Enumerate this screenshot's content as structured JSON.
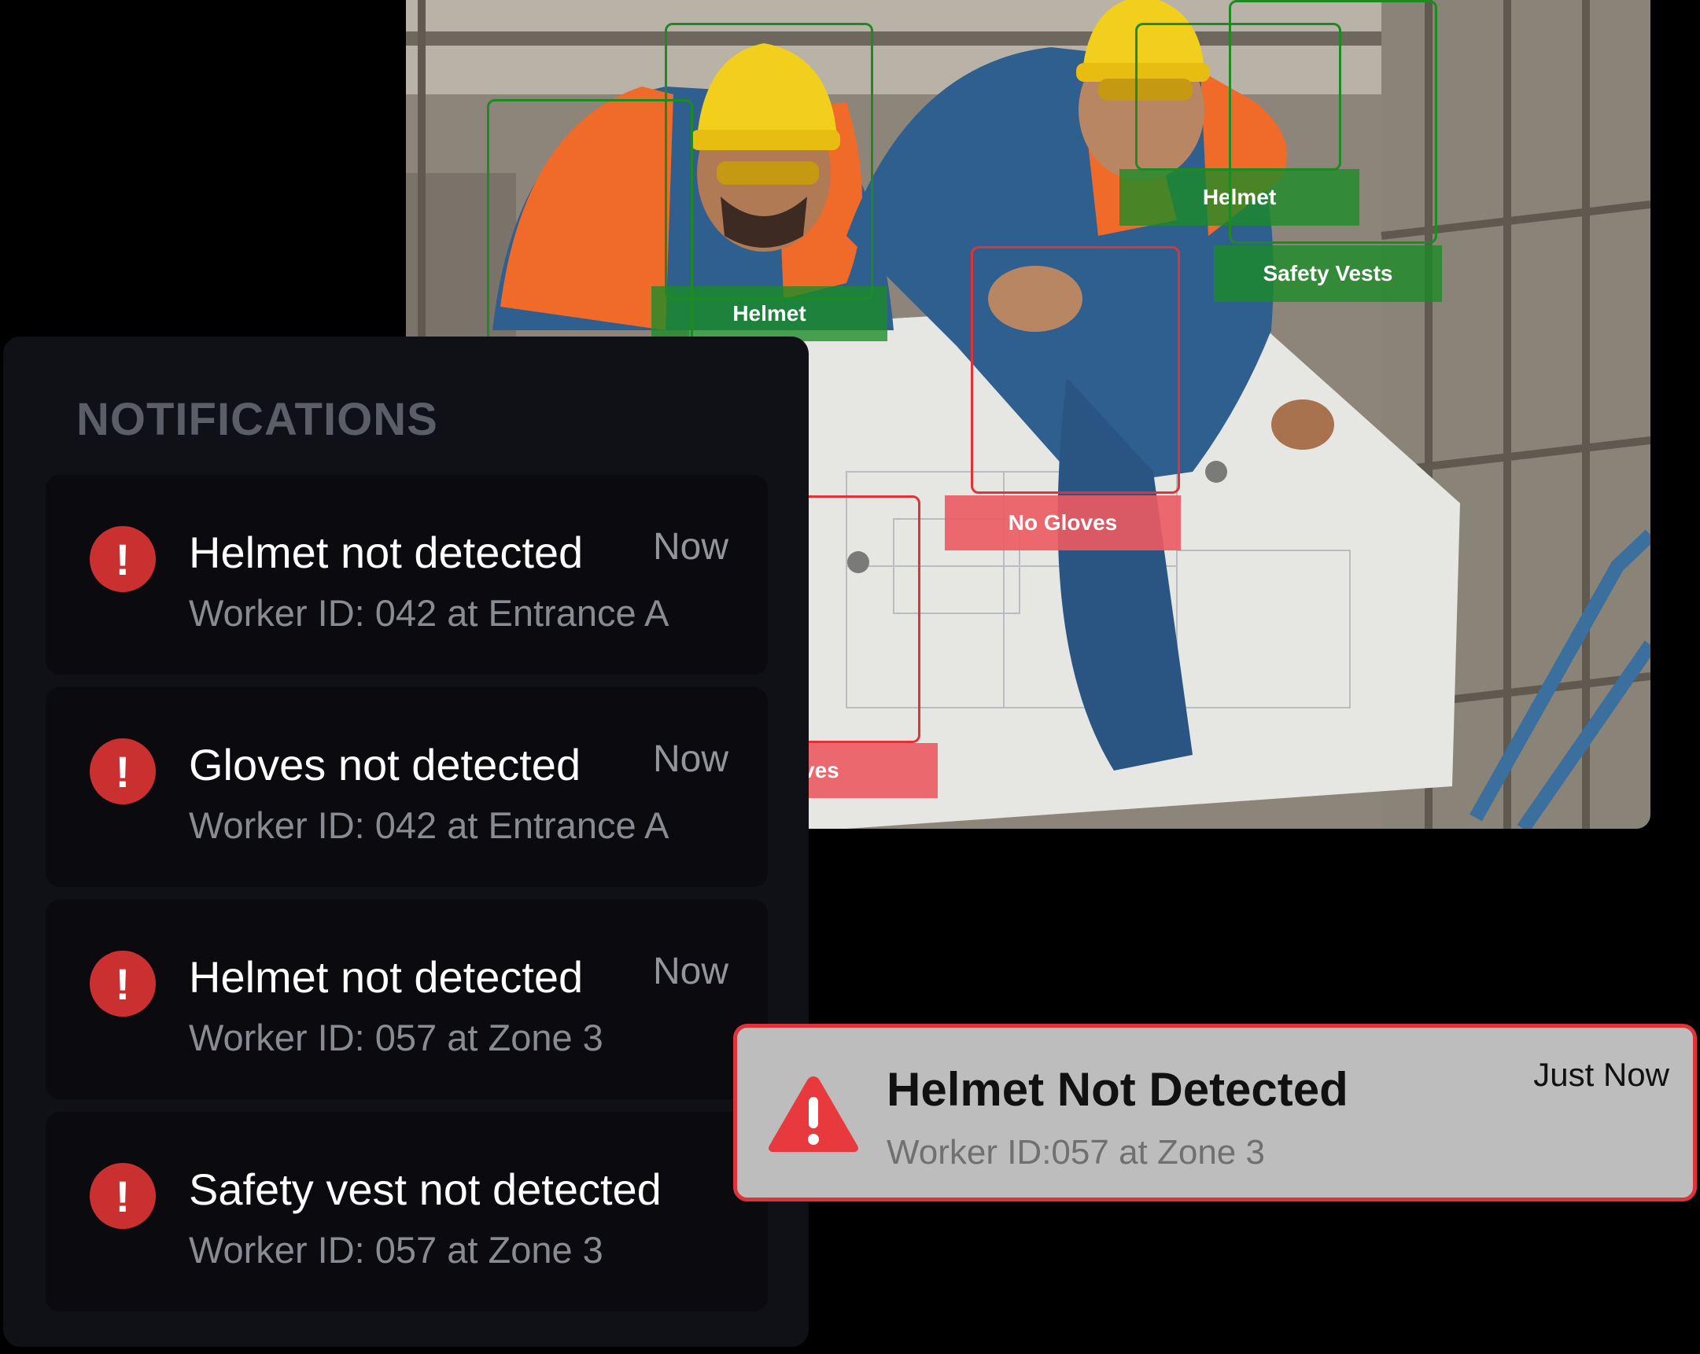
{
  "camera_feed": {
    "detections": [
      {
        "label": "Helmet",
        "status": "detected"
      },
      {
        "label": "Helmet",
        "status": "detected"
      },
      {
        "label": "Safety Vests",
        "status": "detected"
      },
      {
        "label": "No Gloves",
        "status": "violation"
      },
      {
        "label": "ves",
        "status": "violation"
      }
    ]
  },
  "notifications": {
    "heading": "NOTIFICATIONS",
    "items": [
      {
        "title": "Helmet not detected",
        "detail": "Worker ID: 042 at Entrance A",
        "time": "Now",
        "icon": "alert-circle-icon"
      },
      {
        "title": "Gloves not detected",
        "detail": "Worker ID: 042 at Entrance A",
        "time": "Now",
        "icon": "alert-circle-icon"
      },
      {
        "title": "Helmet not detected",
        "detail": "Worker ID: 057 at Zone 3",
        "time": "Now",
        "icon": "alert-circle-icon"
      },
      {
        "title": "Safety vest not detected",
        "detail": "Worker ID: 057 at Zone 3",
        "time": "",
        "icon": "alert-circle-icon"
      }
    ]
  },
  "toast": {
    "title": "Helmet Not Detected",
    "detail": "Worker ID:057 at Zone 3",
    "time": "Just Now",
    "icon": "warning-triangle-icon"
  },
  "colors": {
    "detected": "#1e8a22",
    "violation": "#e0323a",
    "alert_icon": "#c9302f",
    "panel_bg": "#101116",
    "card_bg": "#0a0a0f",
    "toast_bg": "#bdbdbd"
  }
}
